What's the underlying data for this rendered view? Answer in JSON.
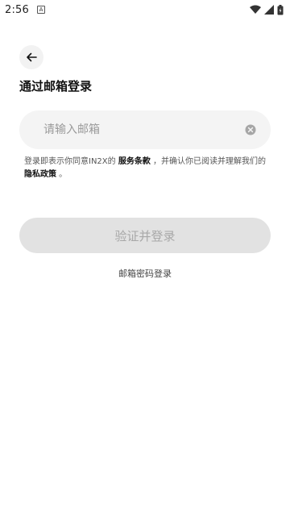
{
  "status_bar": {
    "time": "2:56",
    "notification_glyph": "A",
    "icons": [
      "wifi-icon",
      "signal-icon",
      "battery-icon"
    ]
  },
  "header": {
    "back_icon": "arrow-left-icon",
    "title": "通过邮箱登录"
  },
  "form": {
    "email_placeholder": "请输入邮箱",
    "email_value": "",
    "clear_icon": "clear-icon"
  },
  "terms": {
    "prefix": "登录即表示你同意IN2X的 ",
    "service_link": "服务条款",
    "middle": " ，并确认你已阅读并理解我们的 ",
    "privacy_link": "隐私政策",
    "suffix": " 。"
  },
  "actions": {
    "submit_label": "验证并登录",
    "alt_login_label": "邮箱密码登录"
  },
  "colors": {
    "field_bg": "#f4f4f4",
    "button_disabled_bg": "#e2e2e2",
    "button_disabled_text": "#a8a8a8"
  }
}
